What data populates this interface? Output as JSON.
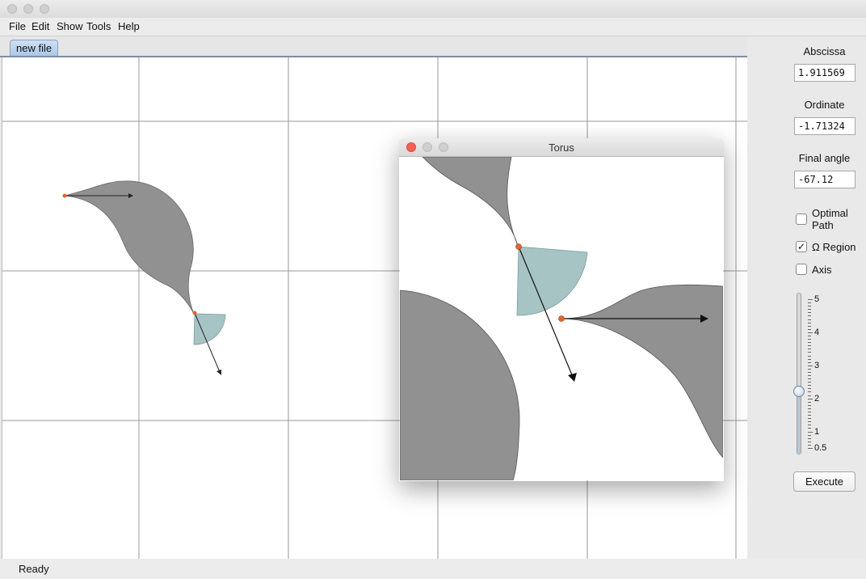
{
  "menu": [
    "File",
    "Edit",
    "Show",
    "Tools",
    "Help"
  ],
  "tab_label": "new file",
  "status": "Ready",
  "fields": {
    "abscissa_label": "Abscissa",
    "abscissa_value": "1.911569",
    "ordinate_label": "Ordinate",
    "ordinate_value": "-1.71324",
    "final_angle_label": "Final angle",
    "final_angle_value": "-67.12"
  },
  "options": {
    "optimal_path": {
      "label_line1": "Optimal",
      "label_line2": "Path",
      "checked": false
    },
    "omega_region": {
      "label": "Ω Region",
      "checked": true
    },
    "axis": {
      "label": "Axis",
      "checked": false
    }
  },
  "slider": {
    "tick_labels": [
      "5",
      "4",
      "3",
      "2",
      "1",
      "0.5"
    ],
    "value": 1.8
  },
  "execute_label": "Execute",
  "torus_window_title": "Torus",
  "colors": {
    "region_gray": "#919191",
    "omega_fill": "#a7c4c4",
    "point_orange": "#e0662f"
  }
}
